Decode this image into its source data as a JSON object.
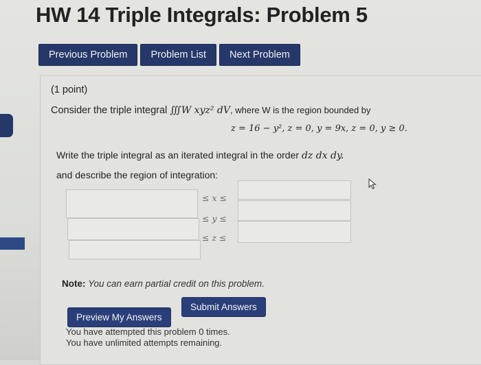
{
  "title": "HW 14 Triple Integrals: Problem 5",
  "nav": {
    "previous": "Previous Problem",
    "list": "Problem List",
    "next": "Next Problem"
  },
  "problem": {
    "points": "(1 point)",
    "prefix": "Consider the triple integral",
    "integral": "∭W xyz² dV",
    "suffix": ", where W is the region bounded by",
    "equations": "z = 16 − y²,    z = 0,    y = 9x,    z = 0,    y ≥ 0.",
    "instruction_prefix": "Write the triple integral as an iterated integral in the order",
    "order": "dz dx dy.",
    "describe": "and describe the region of integration:"
  },
  "inequalities": {
    "x": "≤ x ≤",
    "y": "≤ y ≤",
    "z": "≤ z ≤"
  },
  "note": {
    "label": "Note:",
    "text": "You can earn partial credit on this problem."
  },
  "buttons": {
    "preview": "Preview My Answers",
    "submit": "Submit Answers"
  },
  "attempts": {
    "line1": "You have attempted this problem 0 times.",
    "line2": "You have unlimited attempts remaining."
  },
  "icons": {
    "cursor": "mouse-pointer-icon"
  },
  "colors": {
    "button_bg": "#26386a",
    "page_bg": "#dcddd9"
  }
}
